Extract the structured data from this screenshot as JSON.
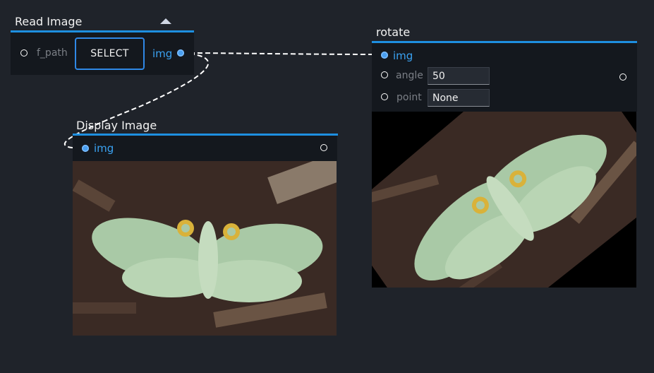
{
  "nodes": {
    "read_image": {
      "title": "Read Image",
      "input_label": "f_path",
      "button_label": "SELECT",
      "output_label": "img"
    },
    "rotate": {
      "title": "rotate",
      "input_label": "img",
      "params": [
        {
          "label": "angle",
          "value": "50"
        },
        {
          "label": "point",
          "value": "None"
        }
      ],
      "image_content": "moth-photo-rotated"
    },
    "display_image": {
      "title": "Display Image",
      "input_label": "img",
      "image_content": "moth-photo"
    }
  },
  "colors": {
    "canvas": "#1f232a",
    "node_body": "#14181e",
    "accent": "#1e8fe0",
    "port_label": "#3aa2f2",
    "wire": "#ffffff"
  }
}
